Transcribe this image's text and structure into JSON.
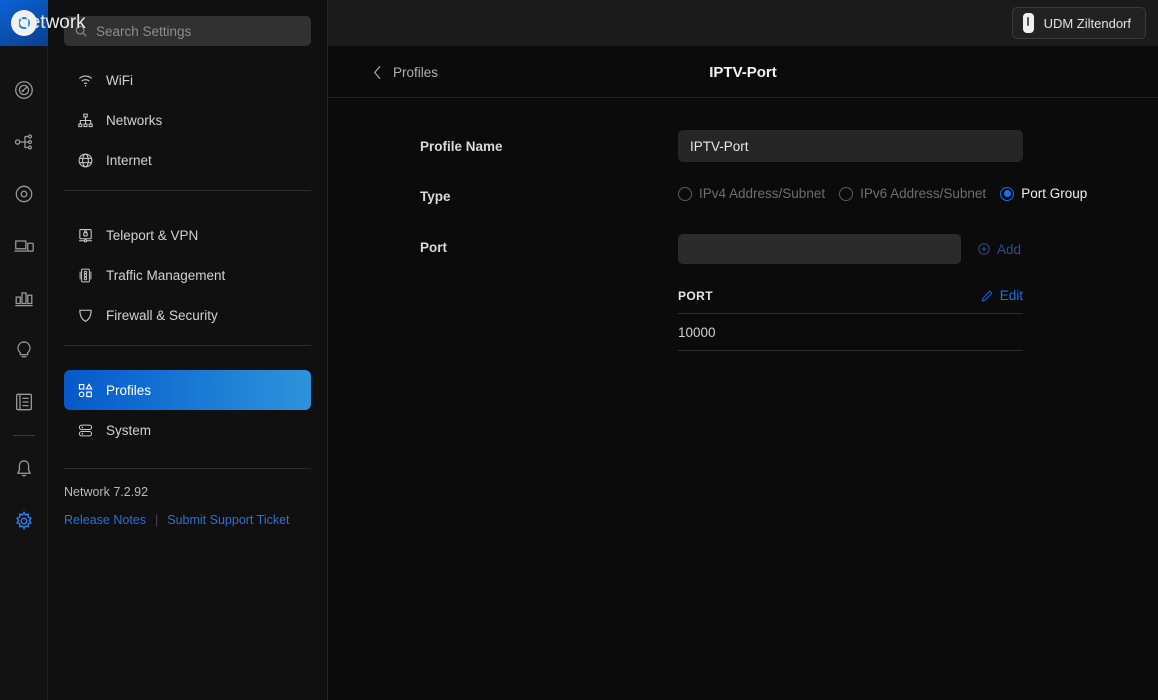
{
  "rail": {
    "logo_name": "unifi-logo",
    "items": [
      {
        "name": "dashboard",
        "icon": "gauge-icon"
      },
      {
        "name": "topology",
        "icon": "topology-icon"
      },
      {
        "name": "unifi-devices",
        "icon": "devices-icon"
      },
      {
        "name": "client-devices",
        "icon": "client-devices-icon"
      },
      {
        "name": "statistics",
        "icon": "bar-chart-icon"
      },
      {
        "name": "hotspot",
        "icon": "lightbulb-icon"
      },
      {
        "name": "logs",
        "icon": "logs-icon"
      }
    ],
    "bottom_items": [
      {
        "name": "notifications",
        "icon": "bell-icon"
      },
      {
        "name": "settings",
        "icon": "gear-icon",
        "active": true
      }
    ]
  },
  "header": {
    "app_title": "Network",
    "device_name": "UDM Ziltendorf",
    "device_icon": "udm-device-icon"
  },
  "search": {
    "placeholder": "Search Settings",
    "value": "",
    "icon": "search-icon"
  },
  "sidebar": {
    "group1": [
      {
        "label": "WiFi",
        "icon": "wifi-icon"
      },
      {
        "label": "Networks",
        "icon": "networks-icon"
      },
      {
        "label": "Internet",
        "icon": "globe-icon"
      }
    ],
    "group2": [
      {
        "label": "Teleport & VPN",
        "icon": "teleport-vpn-icon"
      },
      {
        "label": "Traffic Management",
        "icon": "traffic-light-icon"
      },
      {
        "label": "Firewall & Security",
        "icon": "shield-icon"
      }
    ],
    "group3": [
      {
        "label": "Profiles",
        "icon": "profiles-icon",
        "selected": true
      },
      {
        "label": "System",
        "icon": "system-icon",
        "selected": false
      }
    ],
    "version": "Network 7.2.92",
    "release_notes": "Release Notes",
    "support_ticket": "Submit Support Ticket"
  },
  "content": {
    "breadcrumb": "Profiles",
    "back_icon": "chevron-left-icon",
    "title": "IPTV-Port",
    "profile_name": {
      "label": "Profile Name",
      "value": "IPTV-Port"
    },
    "type": {
      "label": "Type",
      "options": [
        {
          "label": "IPv4 Address/Subnet",
          "checked": false,
          "disabled": true
        },
        {
          "label": "IPv6 Address/Subnet",
          "checked": false,
          "disabled": true
        },
        {
          "label": "Port Group",
          "checked": true,
          "disabled": false
        }
      ]
    },
    "port": {
      "label": "Port",
      "input_value": "",
      "add_label": "Add",
      "add_icon": "circle-plus-icon",
      "edit_label": "Edit",
      "edit_icon": "pencil-icon",
      "table": {
        "columns": [
          "PORT"
        ],
        "rows": [
          [
            "10000"
          ]
        ]
      }
    }
  },
  "colors": {
    "accent_blue": "#1a6ee8",
    "selected_gradient_start": "#0559c9",
    "selected_gradient_end": "#2f93dd",
    "page_bg": "#0b0b0b",
    "sidebar_bg": "#101010",
    "topbar_bg": "#1b1b1b"
  }
}
